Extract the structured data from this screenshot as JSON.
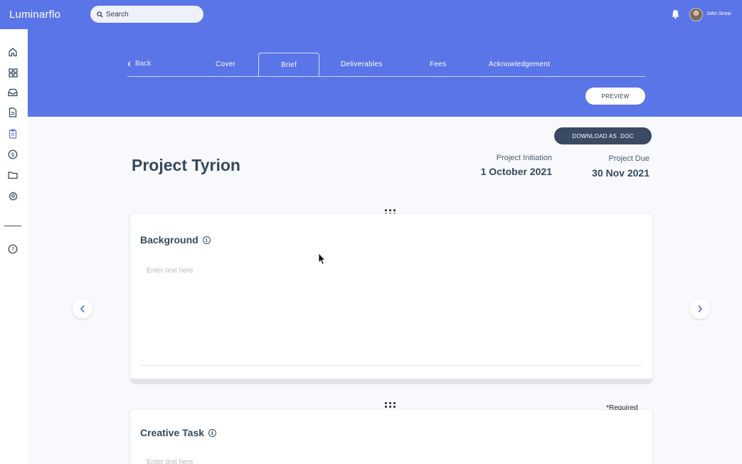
{
  "app": {
    "name": "Luminarflo"
  },
  "search": {
    "placeholder": "Search"
  },
  "user": {
    "name": "John Snow"
  },
  "nav": {
    "back_label": "Back",
    "tabs": [
      {
        "label": "Cover"
      },
      {
        "label": "Brief",
        "active": true
      },
      {
        "label": "Deliverables"
      },
      {
        "label": "Fees"
      },
      {
        "label": "Acknowledgement"
      }
    ],
    "preview_label": "PREVIEW"
  },
  "project": {
    "download_label": "DOWNLOAD AS .DOC",
    "title": "Project Tyrion",
    "initiation_label": "Project Initiation",
    "initiation_date": "1 October 2021",
    "due_label": "Project Due",
    "due_date": "30 Nov 2021"
  },
  "sections": [
    {
      "title": "Background",
      "placeholder": "Enter text here"
    },
    {
      "title": "Creative Task",
      "placeholder": "Enter text here",
      "required_label": "*Required"
    }
  ],
  "colors": {
    "accent": "#5a75e8",
    "dark_button": "#3a4a63",
    "text": "#34495e"
  },
  "icons": {
    "sidebar": [
      "home-icon",
      "dashboard-icon",
      "inbox-icon",
      "document-icon",
      "clipboard-icon",
      "dollar-icon",
      "folder-icon",
      "settings-icon",
      "help-icon"
    ]
  }
}
